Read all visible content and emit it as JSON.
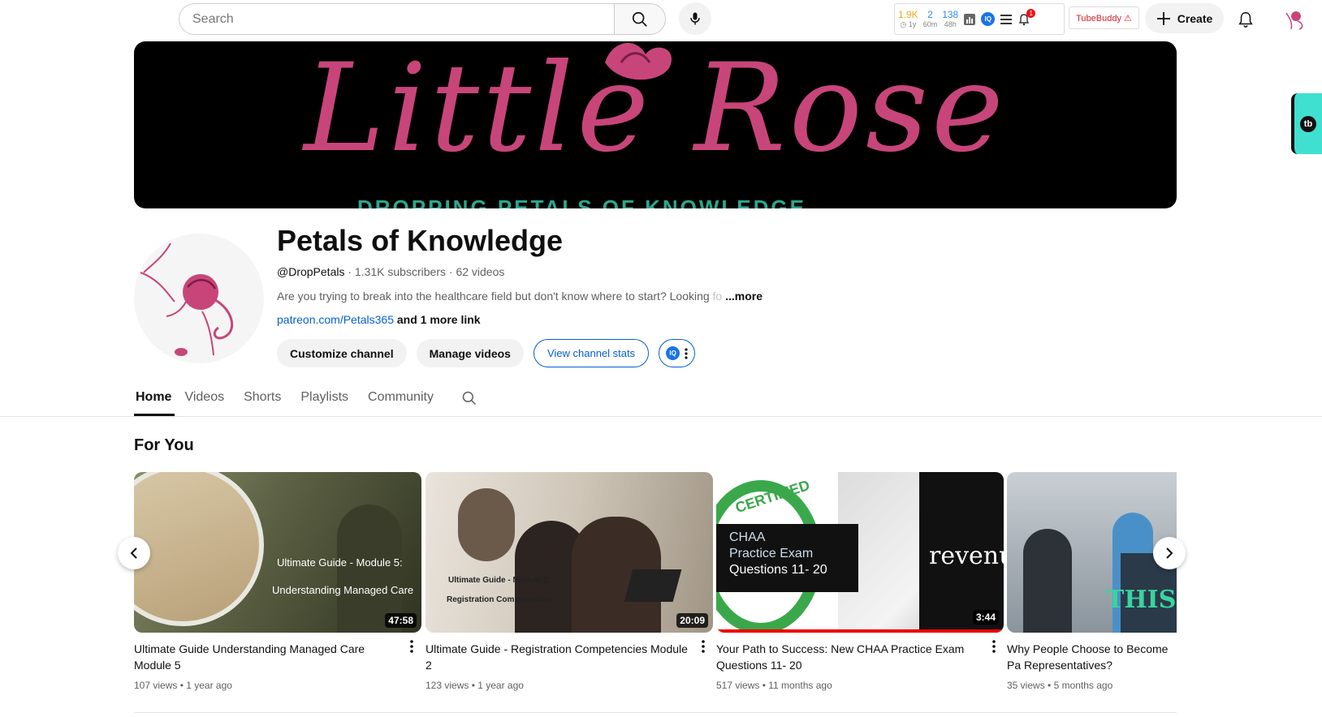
{
  "search": {
    "placeholder": "Search"
  },
  "tubebuddy_widget": {
    "stats": [
      {
        "value": "1.9K",
        "sub": "◷ 1y",
        "color": "#f5a623"
      },
      {
        "value": "2",
        "sub": "60m",
        "color": "#2d8ceb"
      },
      {
        "value": "138",
        "sub": "48h",
        "color": "#2d8ceb"
      }
    ],
    "iq_label": "IQ",
    "badge_count": "1"
  },
  "tubebuddy_button": "TubeBuddy ⚠",
  "create_label": "Create",
  "banner": {
    "title": "Little Rose",
    "subtitle": "DROPPING PETALS OF KNOWLEDGE"
  },
  "side_tab_label": "tb",
  "channel": {
    "name": "Petals of Knowledge",
    "handle": "@DropPetals",
    "subscribers": "1.31K subscribers",
    "videos": "62 videos",
    "description": "Are you trying to break into the healthcare field but don't know where to start?  Looking",
    "description_faded": " fo",
    "more": "...more",
    "link_url": "patreon.com/Petals365",
    "link_more": "and 1 more link",
    "buttons": {
      "customize": "Customize channel",
      "manage": "Manage videos",
      "stats": "View channel stats",
      "iq": "IQ"
    }
  },
  "tabs": [
    "Home",
    "Videos",
    "Shorts",
    "Playlists",
    "Community"
  ],
  "section_title": "For You",
  "videos": [
    {
      "title": "Ultimate Guide Understanding Managed Care Module 5",
      "views": "107 views",
      "age": "1 year ago",
      "duration": "47:58",
      "thumb_line1": "Ultimate Guide - Module 5:",
      "thumb_line2": "Understanding Managed Care"
    },
    {
      "title": "Ultimate Guide - Registration Competencies Module 2",
      "views": "123 views",
      "age": "1 year ago",
      "duration": "20:09",
      "thumb_line1": "Ultimate Guide - Module 2:",
      "thumb_line2": "Registration Competencies"
    },
    {
      "title": "Your Path to Success: New CHAA Practice Exam Questions 11- 20",
      "views": "517 views",
      "age": "11 months ago",
      "duration": "3:44",
      "thumb_line1": "CHAA",
      "thumb_line2": "Practice Exam",
      "thumb_line3": "Questions 11- 20",
      "thumb_badge": "CERTIFIED",
      "thumb_word": "revenue"
    },
    {
      "title": "Why People Choose to Become Pa Representatives?",
      "views": "35 views",
      "age": "5 months ago",
      "thumb_text": "THIS"
    }
  ]
}
